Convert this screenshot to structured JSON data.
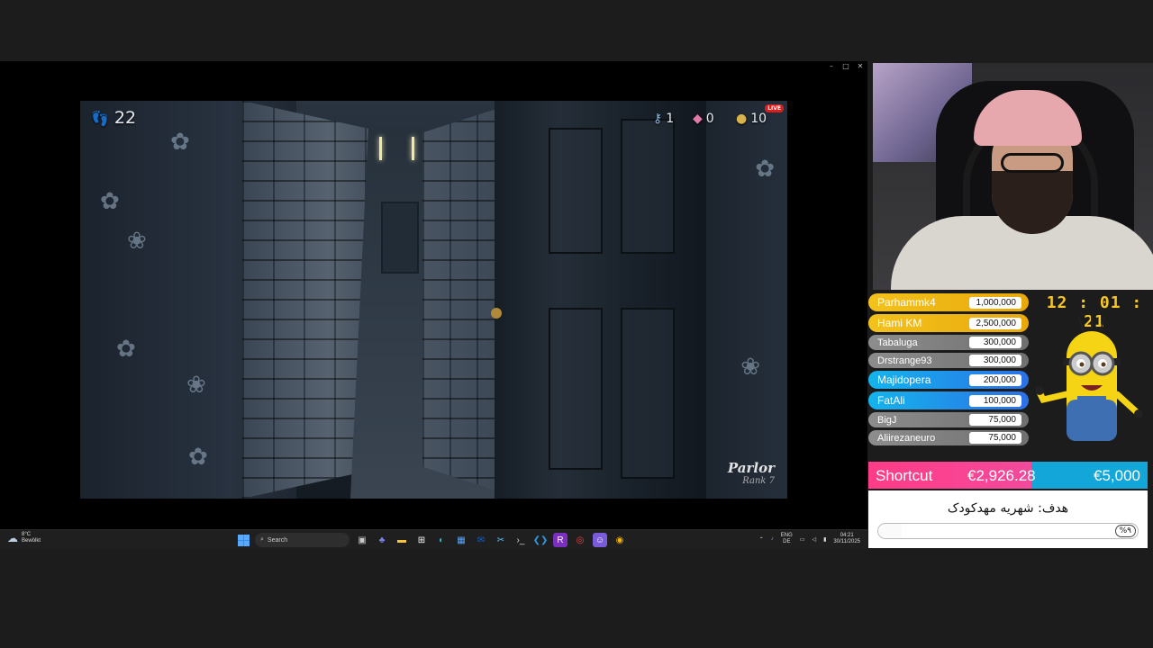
{
  "window": {
    "controls": [
      "–",
      "□",
      "✕"
    ]
  },
  "game": {
    "steps": "22",
    "keys": "1",
    "gems": "0",
    "coins": "10",
    "live_badge": "LIVE",
    "room_name": "Parlor",
    "room_rank": "Rank 7"
  },
  "taskbar": {
    "weather_temp": "8°C",
    "weather_desc": "Bewölkt",
    "search_placeholder": "Search",
    "lang_top": "ENG",
    "lang_bottom": "DE",
    "time": "04:21",
    "date": "30/11/2025"
  },
  "overlay": {
    "timer": "12 : 01 : 21",
    "donors": [
      {
        "name": "Parhammk4",
        "amount": "1,000,000",
        "tier": "gold"
      },
      {
        "name": "Hami KM",
        "amount": "2,500,000",
        "tier": "gold"
      },
      {
        "name": "Tabaluga",
        "amount": "300,000",
        "tier": "gray"
      },
      {
        "name": "Drstrange93",
        "amount": "300,000",
        "tier": "gray"
      },
      {
        "name": "Majidopera",
        "amount": "200,000",
        "tier": "blue"
      },
      {
        "name": "FatAli",
        "amount": "100,000",
        "tier": "blue"
      },
      {
        "name": "BigJ",
        "amount": "75,000",
        "tier": "gray"
      },
      {
        "name": "Aliirezaneuro",
        "amount": "75,000",
        "tier": "gray"
      }
    ],
    "goal": {
      "label": "Shortcut",
      "current": "€2,926.28",
      "target": "€5,000",
      "progress": 0.585
    },
    "fundraiser": {
      "title": "هدف: شهریه مهدکودک",
      "percent_label": "%٩",
      "progress": 0.09
    }
  },
  "colors": {
    "gold": "#f3c21c",
    "blue": "#14b4ec",
    "gray": "#8d8d8d",
    "goal_pink": "#ff3c86",
    "timer": "#f6c629"
  }
}
